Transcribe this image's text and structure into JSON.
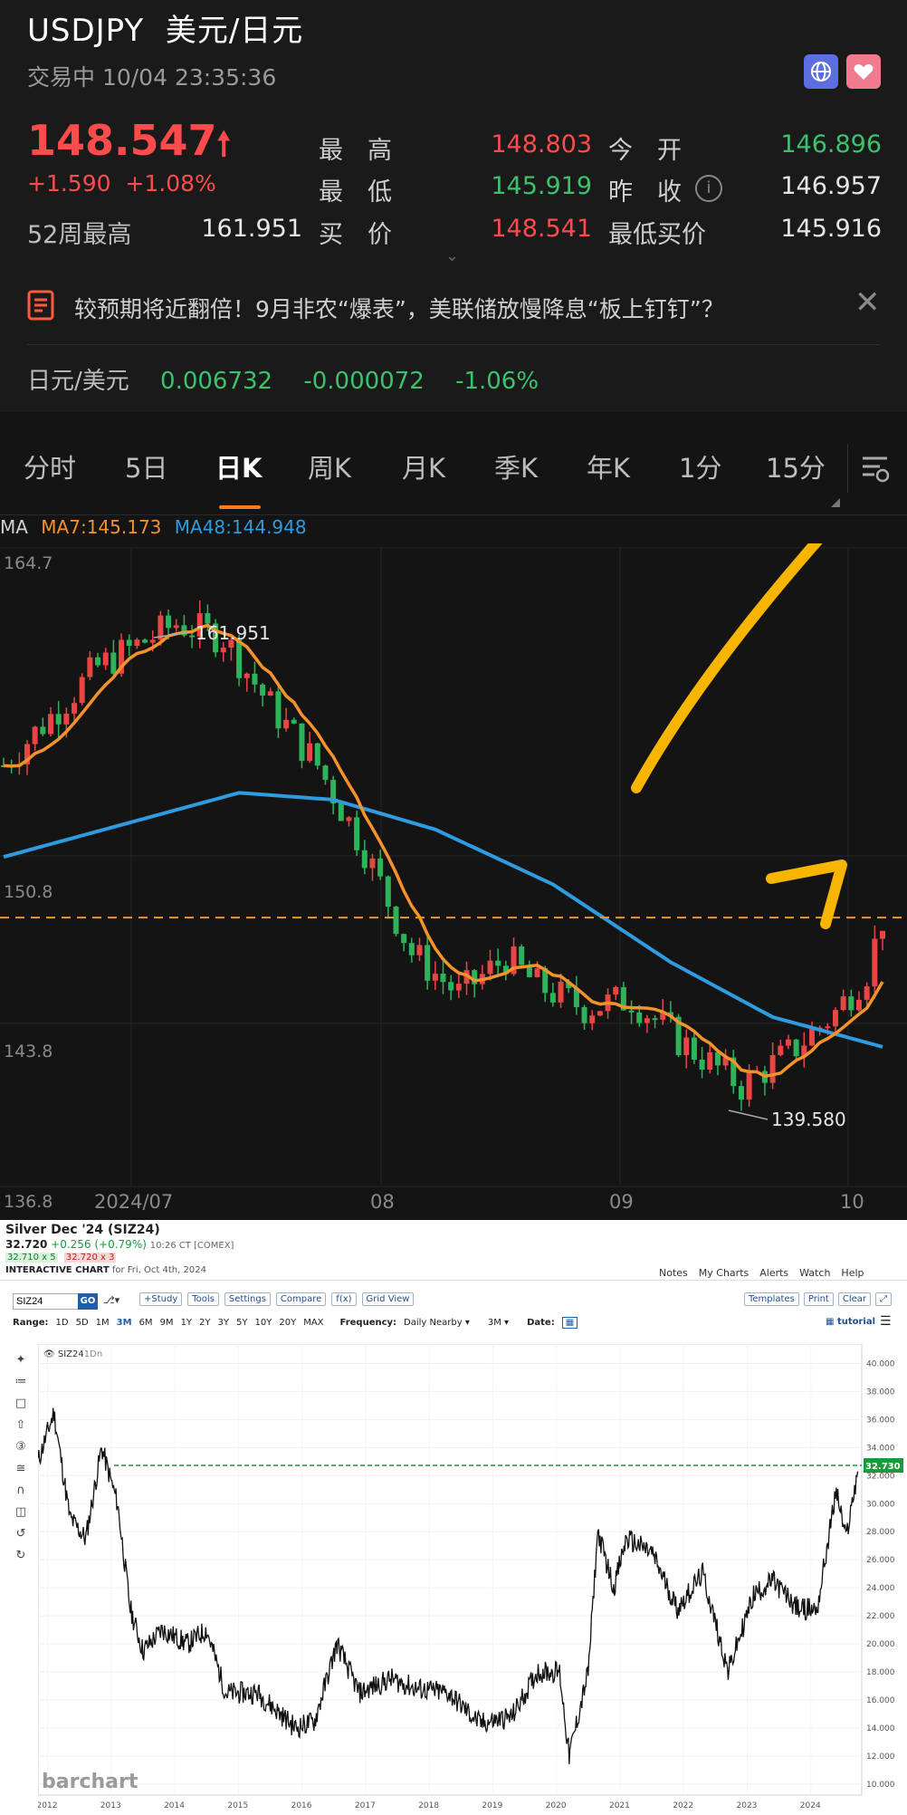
{
  "quote": {
    "symbol": "USDJPY",
    "name": "美元/日元",
    "status": "交易中 10/04 23:35:36",
    "price": "148.547",
    "change": "+1.590",
    "change_pct": "+1.08%",
    "rows": [
      {
        "l1": "最　高",
        "v1": "148.803",
        "l2": "今　开",
        "v2": "146.896"
      },
      {
        "l1": "最　低",
        "v1": "145.919",
        "l2": "昨　收",
        "v2": "146.957"
      },
      {
        "l1": "买　价",
        "v1": "148.541",
        "l2": "最低买价",
        "v2": "145.916"
      }
    ],
    "week52_label": "52周最高",
    "week52_value": "161.951",
    "news": "较预期将近翻倍！9月非农“爆表”，美联储放慢降息“板上钉钉”？",
    "cross_label": "日元/美元",
    "cross_price": "0.006732",
    "cross_change": "-0.000072",
    "cross_pct": "-1.06%"
  },
  "tabs": [
    "分时",
    "5日",
    "日K",
    "周K",
    "月K",
    "季K",
    "年K",
    "1分",
    "15分"
  ],
  "active_tab": "日K",
  "kchart": {
    "ma_label": "MA",
    "ma7": "MA7:145.173",
    "ma48": "MA48:144.948",
    "y_labels": [
      "164.7",
      "150.8",
      "143.8",
      "136.8"
    ],
    "x_labels": [
      "2024/07",
      "08",
      "09",
      "10"
    ],
    "high_label": "161.951",
    "low_label": "139.580",
    "colors": {
      "up": "#e84545",
      "down": "#2fb35a",
      "ma7": "#f5922b",
      "ma48": "#2f9be0",
      "arrow": "#f7b500"
    }
  },
  "silver": {
    "title": "Silver Dec '24 (SIZ24)",
    "last": "32.720",
    "change": "+0.256 (+0.79%)",
    "time": "10:26 CT [COMEX]",
    "bid": "32.710 x 5",
    "ask": "32.720 x 3",
    "chart_label": "INTERACTIVE CHART",
    "chart_date": "for Fri, Oct 4th, 2024",
    "links": [
      "Notes",
      "My Charts",
      "Alerts",
      "Watch",
      "Help"
    ],
    "symbol_input": "SIZ24",
    "go": "GO",
    "toolbar": [
      "+Study",
      "Tools",
      "Settings",
      "Compare",
      "f(x)",
      "Grid View"
    ],
    "right_buttons": [
      "Templates",
      "Print",
      "Clear"
    ],
    "range_label": "Range:",
    "ranges": [
      "1D",
      "5D",
      "1M",
      "3M",
      "6M",
      "9M",
      "1Y",
      "2Y",
      "3Y",
      "5Y",
      "10Y",
      "20Y",
      "MAX"
    ],
    "active_range": "3M",
    "freq_label": "Frequency:",
    "freq_value": "Daily Nearby",
    "period_value": "3M",
    "date_label": "Date:",
    "tutorial": "tutorial",
    "legend": "SIZ24",
    "legend_suffix": "1Dn",
    "watermark": "barchart",
    "last_tag": "32.730",
    "y_ticks": [
      "40.000",
      "38.000",
      "36.000",
      "34.000",
      "32.000",
      "30.000",
      "28.000",
      "26.000",
      "24.000",
      "22.000",
      "20.000",
      "18.000",
      "16.000",
      "14.000",
      "12.000",
      "10.000"
    ],
    "x_ticks": [
      "2012",
      "2013",
      "2014",
      "2015",
      "2016",
      "2017",
      "2018",
      "2019",
      "2020",
      "2021",
      "2022",
      "2023",
      "2024"
    ]
  }
}
